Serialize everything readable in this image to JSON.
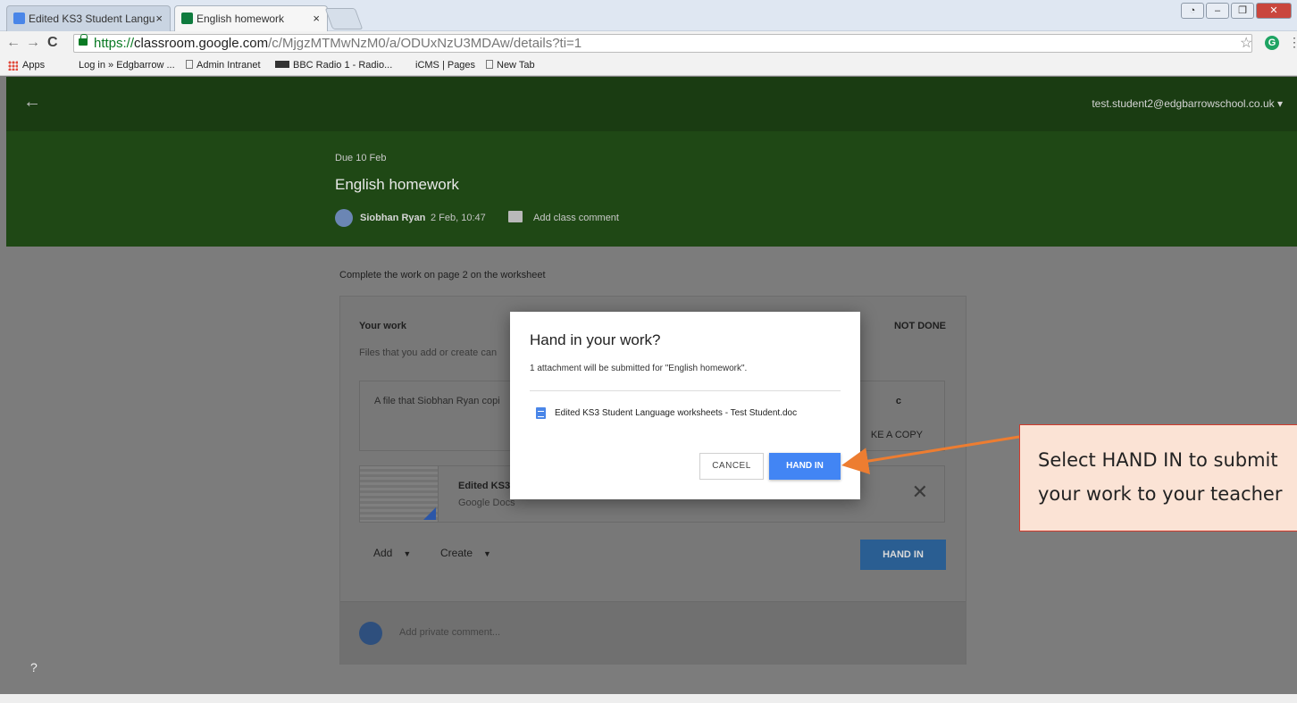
{
  "browser": {
    "tabs": [
      {
        "label": "Edited KS3 Student Langu",
        "icon": "google-docs-icon",
        "active": false
      },
      {
        "label": "English homework",
        "icon": "google-classroom-icon",
        "active": true
      }
    ],
    "window_controls": [
      "minimize",
      "restore",
      "close"
    ],
    "url": {
      "scheme": "https://",
      "host": "classroom.google.com",
      "path": "/c/MjgzMTMwNzM0/a/ODUxNzU3MDAw/details?ti=1"
    },
    "nav_icons": [
      "back-arrow-icon",
      "forward-arrow-icon",
      "reload-icon"
    ],
    "bookmarks": [
      {
        "label": "Apps",
        "icon": "apps-grid-icon"
      },
      {
        "label": "Log in » Edgbarrow ...",
        "icon": ""
      },
      {
        "label": "Admin Intranet",
        "icon": "page-icon"
      },
      {
        "label": "BBC Radio 1 - Radio...",
        "icon": "bbc-icon"
      },
      {
        "label": "iCMS | Pages",
        "icon": ""
      },
      {
        "label": "New Tab",
        "icon": "page-icon"
      }
    ]
  },
  "topbar": {
    "account": "test.student2@edgbarrowschool.co.uk",
    "account_caret": "▾"
  },
  "assignment": {
    "due": "Due 10 Feb",
    "title": "English homework",
    "author": "Siobhan Ryan",
    "posted": "2 Feb, 10:47",
    "add_class_comment": "Add class comment",
    "instructions": "Complete the work on page 2 on the worksheet"
  },
  "work_card": {
    "heading": "Your work",
    "status": "NOT DONE",
    "files_note": "Files that you add or create can",
    "copy_text": "A file that Siobhan Ryan copi",
    "copy_extra_1": "c",
    "copy_extra_2": "KE A COPY",
    "attachment_name": "Edited KS3",
    "attachment_type": "Google Docs",
    "add_label": "Add",
    "create_label": "Create",
    "hand_in_label": "HAND IN",
    "private_comment_placeholder": "Add private comment..."
  },
  "dialog": {
    "title": "Hand in your work?",
    "subtitle": "1 attachment will be submitted for \"English homework\".",
    "file": "Edited KS3 Student Language worksheets - Test Student.doc",
    "cancel_label": "CANCEL",
    "hand_in_label": "HAND IN"
  },
  "callout": {
    "text": "Select HAND IN to submit\nyour work to your teacher",
    "colors": {
      "fill": "#fbe3d5",
      "border": "#d23a2b",
      "arrow": "#ed7d31"
    }
  },
  "help_label": "?",
  "colors": {
    "classroom_green": "#1f4815",
    "hand_in_blue": "#4285f4",
    "overlay_grey": "#7c7c7c"
  }
}
